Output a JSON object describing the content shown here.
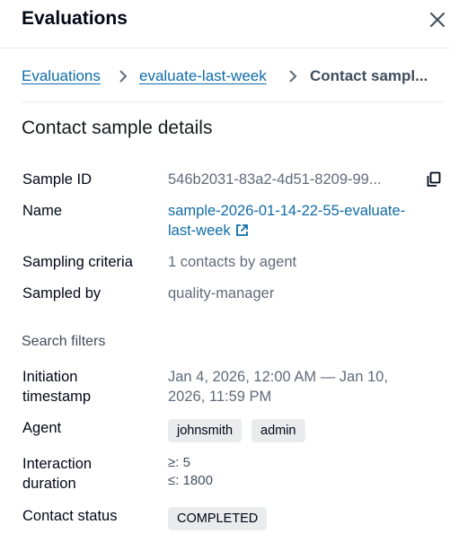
{
  "header": {
    "title": "Evaluations",
    "close_icon": "close-icon"
  },
  "breadcrumb": {
    "items": [
      "Evaluations",
      "evaluate-last-week"
    ],
    "current": "Contact sampl..."
  },
  "section": {
    "title": "Contact sample details"
  },
  "details": {
    "sample_id": {
      "label": "Sample ID",
      "value": "546b2031-83a2-4d51-8209-99..."
    },
    "name": {
      "label": "Name",
      "value_line1": "sample-2026-01-14-22-55-evaluate-",
      "value_line2": "last-week"
    },
    "sampling_criteria": {
      "label": "Sampling criteria",
      "value": "1 contacts by agent"
    },
    "sampled_by": {
      "label": "Sampled by",
      "value": "quality-manager"
    }
  },
  "filters": {
    "heading": "Search filters",
    "initiation": {
      "label_line1": "Initiation",
      "label_line2": "timestamp",
      "value_line1": "Jan 4, 2026, 12:00 AM — Jan 10,",
      "value_line2": "2026, 11:59 PM"
    },
    "agent": {
      "label": "Agent",
      "badges": [
        "johnsmith",
        "admin"
      ]
    },
    "duration": {
      "label_line1": "Interaction",
      "label_line2": "duration",
      "min": "≥: 5",
      "max": "≤: 1800"
    },
    "status": {
      "label": "Contact status",
      "badge": "COMPLETED"
    }
  },
  "colors": {
    "link": "#0f6ca8",
    "badge_bg": "#e9ebed",
    "muted_text": "#5f6b7a"
  }
}
